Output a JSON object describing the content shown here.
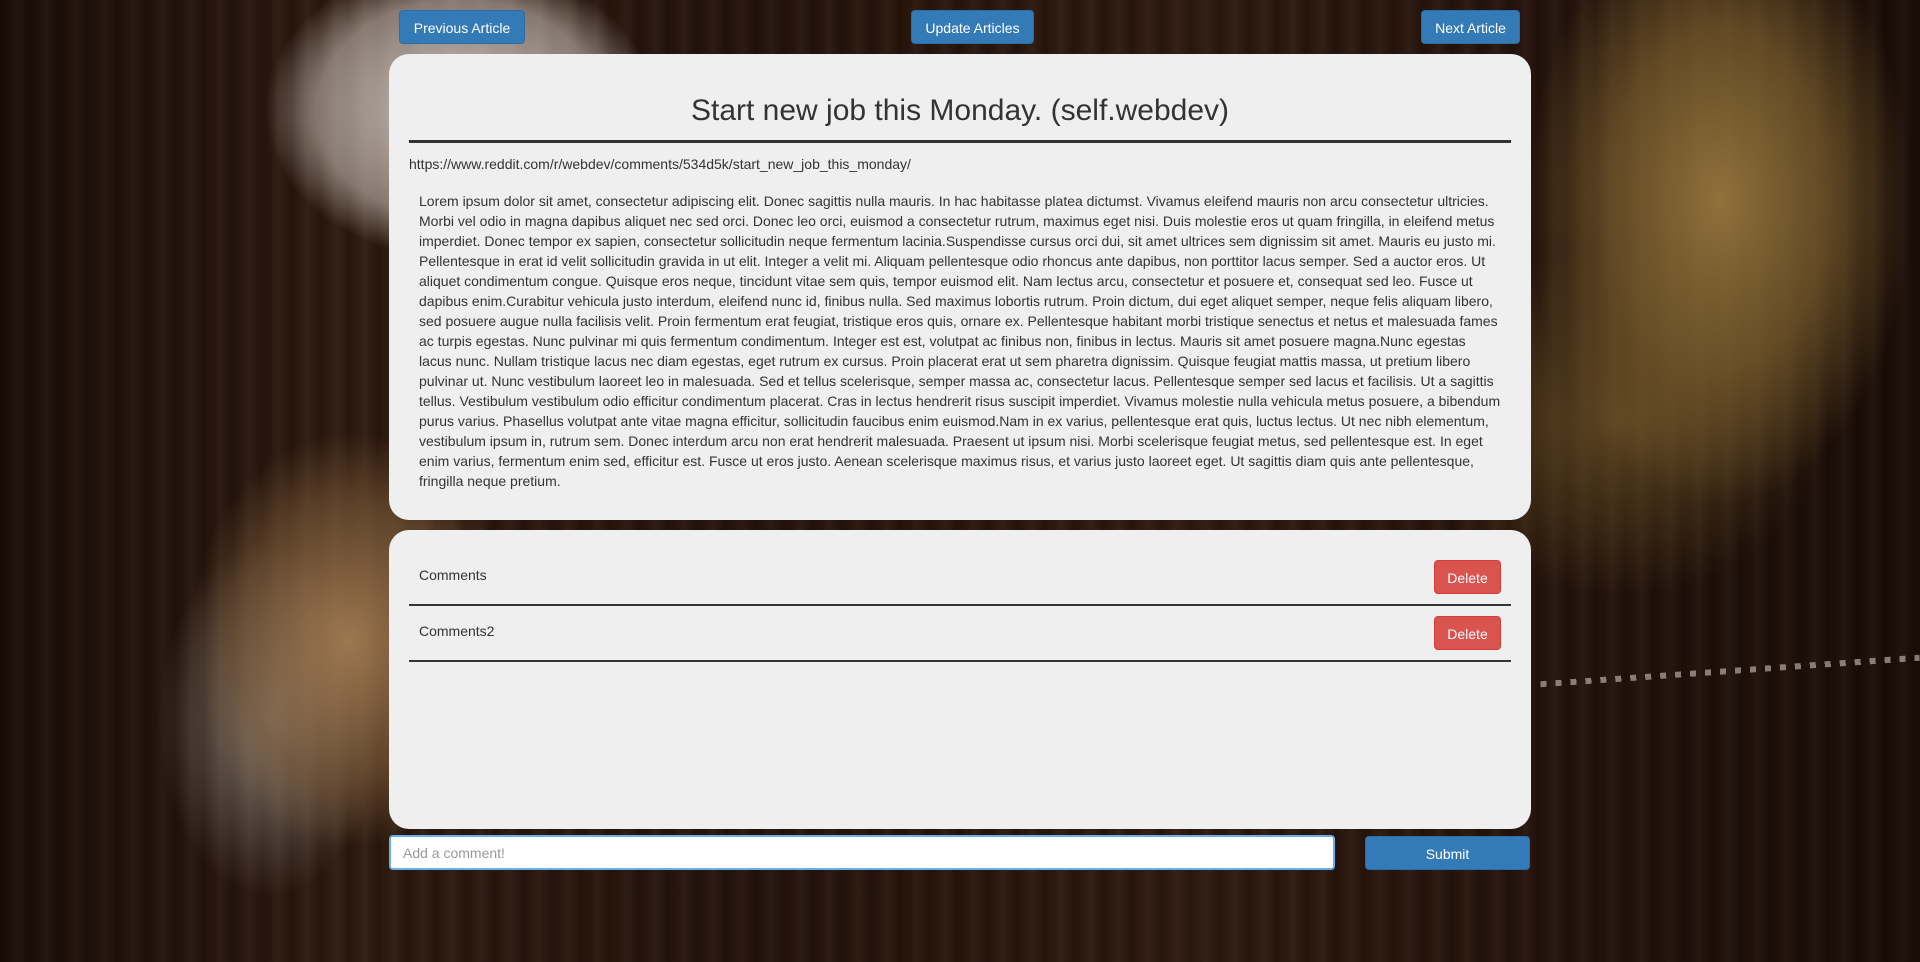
{
  "nav": {
    "previous_label": "Previous Article",
    "update_label": "Update Articles",
    "next_label": "Next Article"
  },
  "article": {
    "title": "Start new job this Monday. (self.webdev)",
    "url": "https://www.reddit.com/r/webdev/comments/534d5k/start_new_job_this_monday/",
    "body": "Lorem ipsum dolor sit amet, consectetur adipiscing elit. Donec sagittis nulla mauris. In hac habitasse platea dictumst. Vivamus eleifend mauris non arcu consectetur ultricies. Morbi vel odio in magna dapibus aliquet nec sed orci. Donec leo orci, euismod a consectetur rutrum, maximus eget nisi. Duis molestie eros ut quam fringilla, in eleifend metus imperdiet. Donec tempor ex sapien, consectetur sollicitudin neque fermentum lacinia.Suspendisse cursus orci dui, sit amet ultrices sem dignissim sit amet. Mauris eu justo mi. Pellentesque in erat id velit sollicitudin gravida in ut elit. Integer a velit mi. Aliquam pellentesque odio rhoncus ante dapibus, non porttitor lacus semper. Sed a auctor eros. Ut aliquet condimentum congue. Quisque eros neque, tincidunt vitae sem quis, tempor euismod elit. Nam lectus arcu, consectetur et posuere et, consequat sed leo. Fusce ut dapibus enim.Curabitur vehicula justo interdum, eleifend nunc id, finibus nulla. Sed maximus lobortis rutrum. Proin dictum, dui eget aliquet semper, neque felis aliquam libero, sed posuere augue nulla facilisis velit. Proin fermentum erat feugiat, tristique eros quis, ornare ex. Pellentesque habitant morbi tristique senectus et netus et malesuada fames ac turpis egestas. Nunc pulvinar mi quis fermentum condimentum. Integer est est, volutpat ac finibus non, finibus in lectus. Mauris sit amet posuere magna.Nunc egestas lacus nunc. Nullam tristique lacus nec diam egestas, eget rutrum ex cursus. Proin placerat erat ut sem pharetra dignissim. Quisque feugiat mattis massa, ut pretium libero pulvinar ut. Nunc vestibulum laoreet leo in malesuada. Sed et tellus scelerisque, semper massa ac, consectetur lacus. Pellentesque semper sed lacus et facilisis. Ut a sagittis tellus. Vestibulum vestibulum odio efficitur condimentum placerat. Cras in lectus hendrerit risus suscipit imperdiet. Vivamus molestie nulla vehicula metus posuere, a bibendum purus varius. Phasellus volutpat ante vitae magna efficitur, sollicitudin faucibus enim euismod.Nam in ex varius, pellentesque erat quis, luctus lectus. Ut nec nibh elementum, vestibulum ipsum in, rutrum sem. Donec interdum arcu non erat hendrerit malesuada. Praesent ut ipsum nisi. Morbi scelerisque feugiat metus, sed pellentesque est. In eget enim varius, fermentum enim sed, efficitur est. Fusce ut eros justo. Aenean scelerisque maximus risus, et varius justo laoreet eget. Ut sagittis diam quis ante pellentesque, fringilla neque pretium."
  },
  "comments": [
    {
      "text": "Comments",
      "delete_label": "Delete"
    },
    {
      "text": "Comments2",
      "delete_label": "Delete"
    }
  ],
  "comment_form": {
    "placeholder": "Add a comment!",
    "submit_label": "Submit"
  },
  "colors": {
    "primary": "#337ab7",
    "danger": "#d9534f",
    "panel": "#efefef",
    "input_focus_border": "#66afe9"
  }
}
